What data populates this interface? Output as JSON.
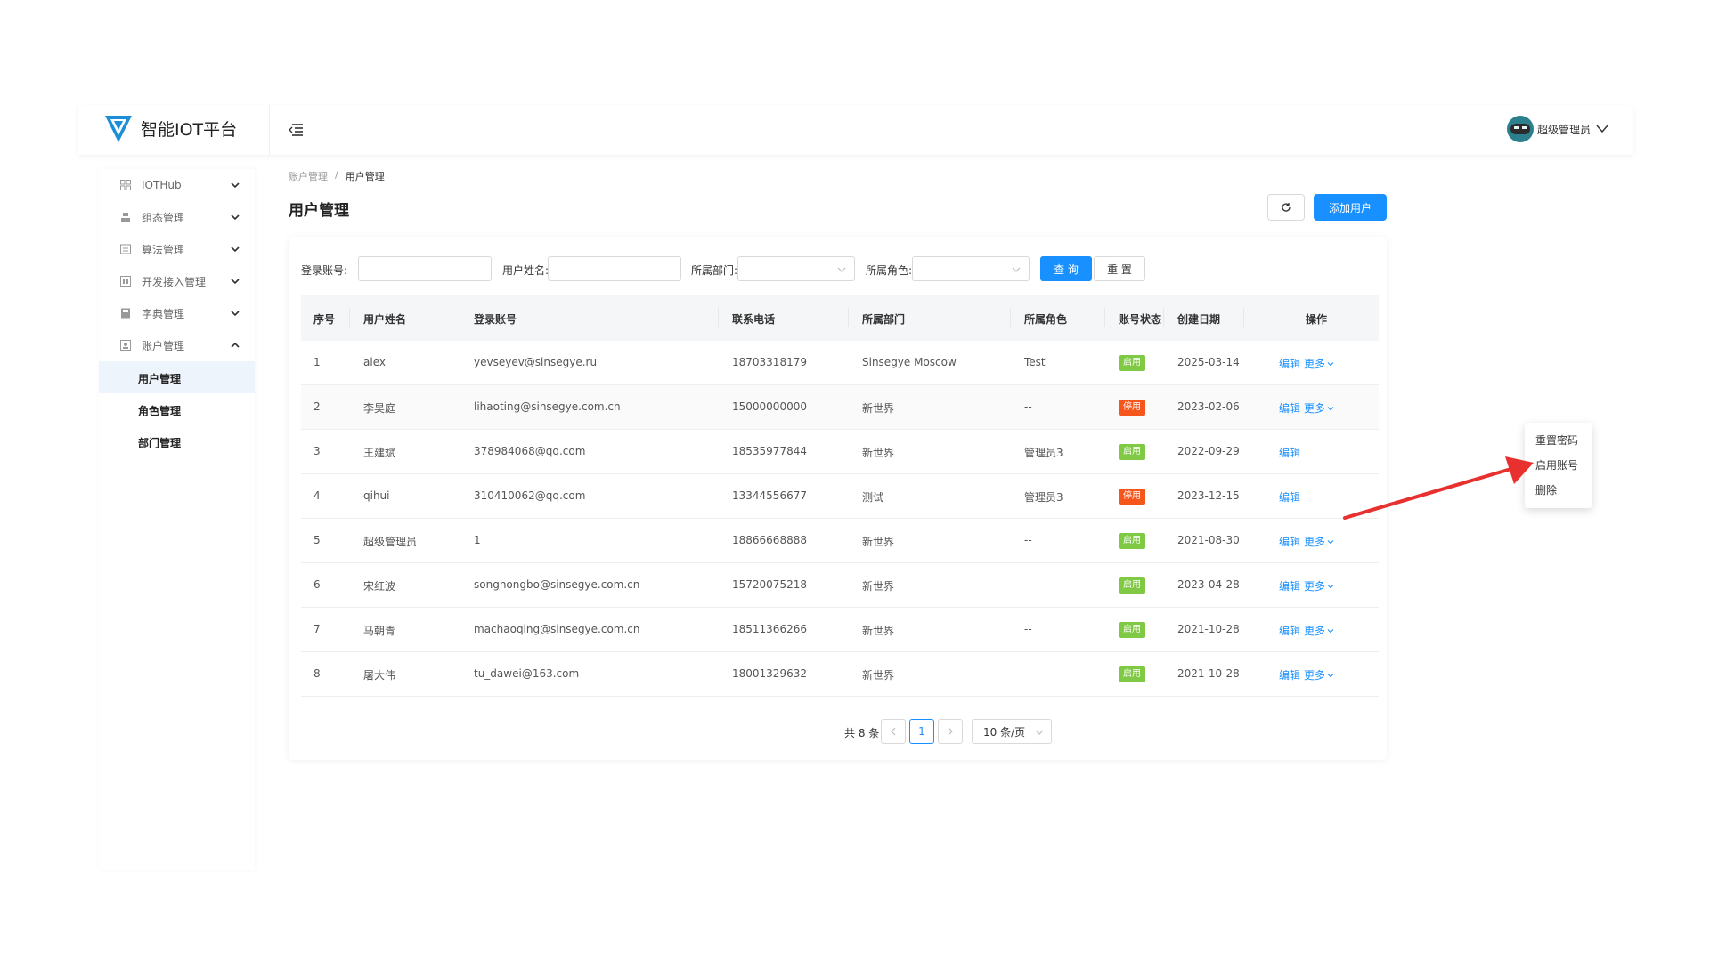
{
  "app": {
    "title": "智能IOT平台"
  },
  "user": {
    "name": "超级管理员"
  },
  "sidebar": {
    "items": [
      {
        "label": "IOTHub",
        "icon": "grid-icon",
        "expanded": false
      },
      {
        "label": "组态管理",
        "icon": "layers-icon",
        "expanded": false
      },
      {
        "label": "算法管理",
        "icon": "algorithm-icon",
        "expanded": false
      },
      {
        "label": "开发接入管理",
        "icon": "dev-access-icon",
        "expanded": false
      },
      {
        "label": "字典管理",
        "icon": "dictionary-icon",
        "expanded": false
      },
      {
        "label": "账户管理",
        "icon": "account-icon",
        "expanded": true
      }
    ],
    "sub_items": [
      {
        "label": "用户管理",
        "active": true
      },
      {
        "label": "角色管理",
        "active": false
      },
      {
        "label": "部门管理",
        "active": false
      }
    ]
  },
  "breadcrumb": {
    "parent": "账户管理",
    "separator": "/",
    "current": "用户管理"
  },
  "page": {
    "title": "用户管理",
    "add_button": "添加用户"
  },
  "filters": {
    "login_account_label": "登录账号:",
    "user_name_label": "用户姓名:",
    "department_label": "所属部门:",
    "role_label": "所属角色:",
    "query_button": "查 询",
    "reset_button": "重 置"
  },
  "table": {
    "headers": [
      "序号",
      "用户姓名",
      "登录账号",
      "联系电话",
      "所属部门",
      "所属角色",
      "账号状态",
      "创建日期",
      "操作"
    ],
    "rows": [
      {
        "no": "1",
        "name": "alex",
        "account": "yevseyev@sinsegye.ru",
        "phone": "18703318179",
        "dept": "Sinsegye Moscow",
        "role": "Test",
        "status": "启用",
        "status_color": "#7fc944",
        "date": "2025-03-14"
      },
      {
        "no": "2",
        "name": "李昊庭",
        "account": "lihaoting@sinsegye.com.cn",
        "phone": "15000000000",
        "dept": "新世界",
        "role": "--",
        "status": "停用",
        "status_color": "#f5561b",
        "date": "2023-02-06"
      },
      {
        "no": "3",
        "name": "王建斌",
        "account": "378984068@qq.com",
        "phone": "18535977844",
        "dept": "新世界",
        "role": "管理员3",
        "status": "启用",
        "status_color": "#7fc944",
        "date": "2022-09-29"
      },
      {
        "no": "4",
        "name": "qihui",
        "account": "310410062@qq.com",
        "phone": "13344556677",
        "dept": "测试",
        "role": "管理员3",
        "status": "停用",
        "status_color": "#f5561b",
        "date": "2023-12-15"
      },
      {
        "no": "5",
        "name": "超级管理员",
        "account": "1",
        "phone": "18866668888",
        "dept": "新世界",
        "role": "--",
        "status": "启用",
        "status_color": "#7fc944",
        "date": "2021-08-30"
      },
      {
        "no": "6",
        "name": "宋红波",
        "account": "songhongbo@sinsegye.com.cn",
        "phone": "15720075218",
        "dept": "新世界",
        "role": "--",
        "status": "启用",
        "status_color": "#7fc944",
        "date": "2023-04-28"
      },
      {
        "no": "7",
        "name": "马朝青",
        "account": "machaoqing@sinsegye.com.cn",
        "phone": "18511366266",
        "dept": "新世界",
        "role": "--",
        "status": "启用",
        "status_color": "#7fc944",
        "date": "2021-10-28"
      },
      {
        "no": "8",
        "name": "屠大伟",
        "account": "tu_dawei@163.com",
        "phone": "18001329632",
        "dept": "新世界",
        "role": "--",
        "status": "启用",
        "status_color": "#7fc944",
        "date": "2021-10-28"
      }
    ],
    "op_edit": "编辑",
    "op_more": "更多"
  },
  "pagination": {
    "total": "共 8 条",
    "current_page": "1",
    "page_size": "10 条/页"
  },
  "dropdown": {
    "items": [
      "重置密码",
      "启用账号",
      "删除"
    ]
  },
  "colors": {
    "primary": "#1890ff",
    "enabled": "#7fc944",
    "disabled": "#f5561b",
    "annotation_arrow": "#e8302f"
  }
}
